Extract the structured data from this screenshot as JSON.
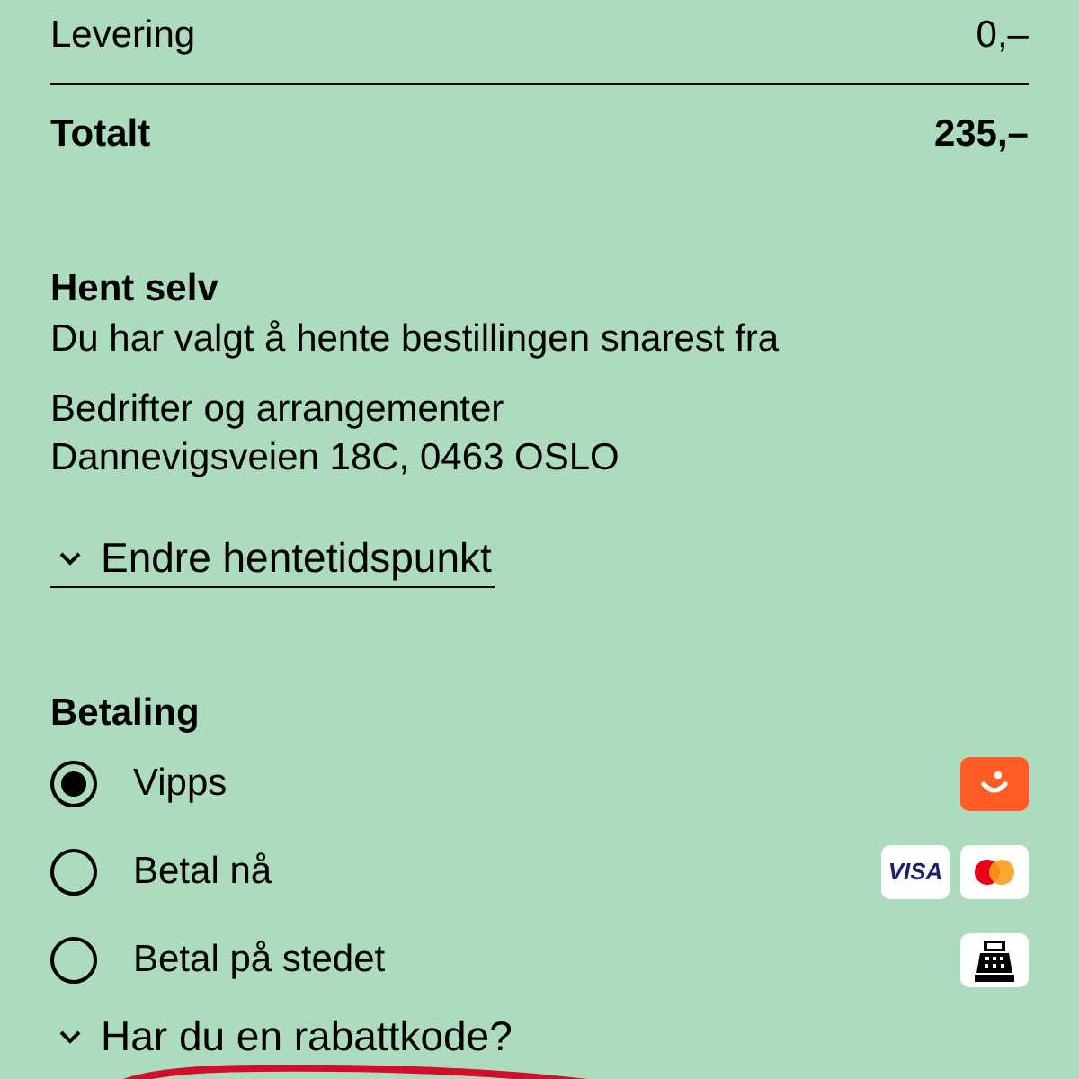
{
  "summary": {
    "rows": [
      {
        "label": "Levering",
        "amount": "0,–"
      }
    ],
    "total": {
      "label": "Totalt",
      "amount": "235,–"
    }
  },
  "pickup": {
    "title": "Hent selv",
    "description": "Du har valgt å hente bestillingen snarest fra",
    "location_name": "Bedrifter og arrangementer",
    "address": "Dannevigsveien 18C, 0463 OSLO",
    "change_link": {
      "label": "Endre hentetidspunkt",
      "expanded": false
    }
  },
  "payment": {
    "title": "Betaling",
    "options": [
      {
        "label": "Vipps",
        "selected": true,
        "badges": [
          {
            "kind": "vipps"
          }
        ]
      },
      {
        "label": "Betal nå",
        "selected": false,
        "badges": [
          {
            "kind": "visa",
            "text": "VISA"
          },
          {
            "kind": "mastercard"
          }
        ]
      },
      {
        "label": "Betal på stedet",
        "selected": false,
        "badges": [
          {
            "kind": "register"
          }
        ]
      }
    ]
  },
  "discount": {
    "label": "Har du en rabattkode?",
    "expanded": false
  }
}
